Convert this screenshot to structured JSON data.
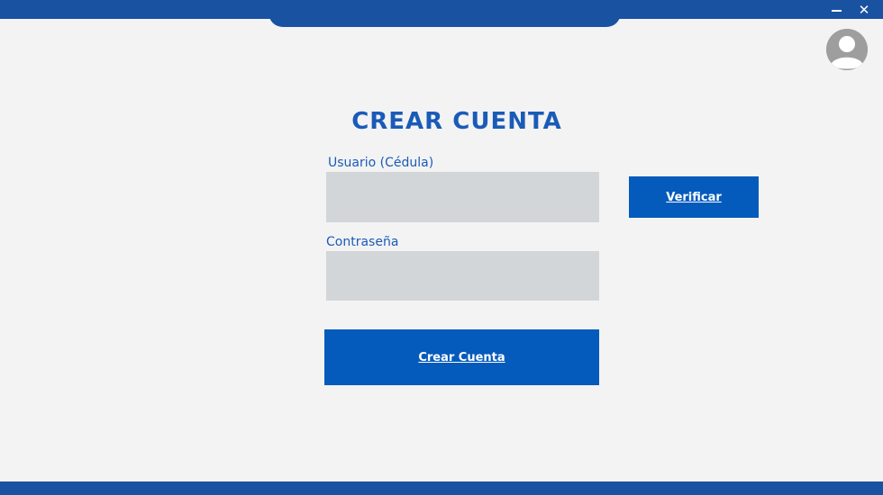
{
  "window": {
    "minimize_icon": "minimize-icon",
    "close_glyph": "✕",
    "accent_color": "#1a52a2"
  },
  "form": {
    "title": "Crear Cuenta",
    "user_label": "Usuario (Cédula)",
    "user_value": "",
    "password_label": "Contraseña",
    "password_value": "",
    "verify_label": "Verificar",
    "create_label": "Crear Cuenta",
    "button_color": "#045bbb"
  }
}
